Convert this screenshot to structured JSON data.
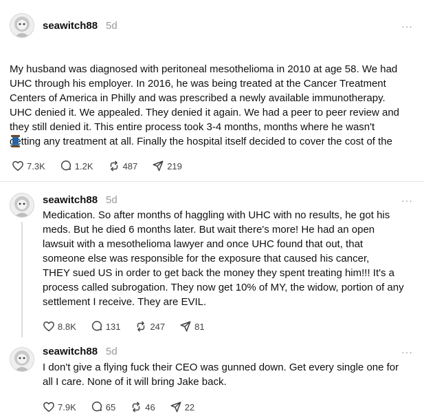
{
  "posts": [
    {
      "username": "seawitch88",
      "time": "5d",
      "more": "···",
      "text": "My husband was diagnosed with peritoneal mesothelioma in 2010 at age 58. We had\nUHC through his employer. In 2016, he was being treated at the Cancer Treatment\nCenters of America in Philly and was prescribed a newly available immunotherapy.\nUHC denied it. We appealed. They denied it again. We had a peer to peer review and\nthey still denied it. This entire process took 3-4 months, months where he wasn't\ngetting any treatment at all. Finally the hospital itself decided to cover the cost of the",
      "emoji_icon": "thread-spool-icon",
      "likes": "7.3K",
      "replies": "1.2K",
      "reposts": "487",
      "shares": "219"
    },
    {
      "username": "seawitch88",
      "time": "5d",
      "more": "···",
      "text": "Medication. So after months of haggling with UHC with no results, he got his\nmeds. But he died 6 months later. But wait there's more! He had an open\nlawsuit with a mesothelioma lawyer and once UHC found that out, that\nsomeone else was responsible for the exposure that caused his cancer,\nTHEY sued US in order to get back the money they spent treating him!!! It's a\nprocess called subrogation. They now get 10% of MY, the widow, portion of any\nsettlement I receive. They are EVIL.",
      "likes": "8.8K",
      "replies": "131",
      "reposts": "247",
      "shares": "81"
    },
    {
      "username": "seawitch88",
      "time": "5d",
      "more": "···",
      "text": "I don't give a flying fuck their CEO was gunned down. Get every single one for\nall I care. None of it will bring Jake back.",
      "likes": "7.9K",
      "replies": "65",
      "reposts": "46",
      "shares": "22"
    }
  ],
  "icons": {
    "like": "heart-icon",
    "reply": "comment-icon",
    "repost": "repost-icon",
    "share": "share-icon",
    "avatar": "avatar-icon"
  },
  "colors": {
    "text": "#101010",
    "muted": "#9a9a9a",
    "divider": "#e4e4e4",
    "thread_line": "#dcdcdc"
  }
}
